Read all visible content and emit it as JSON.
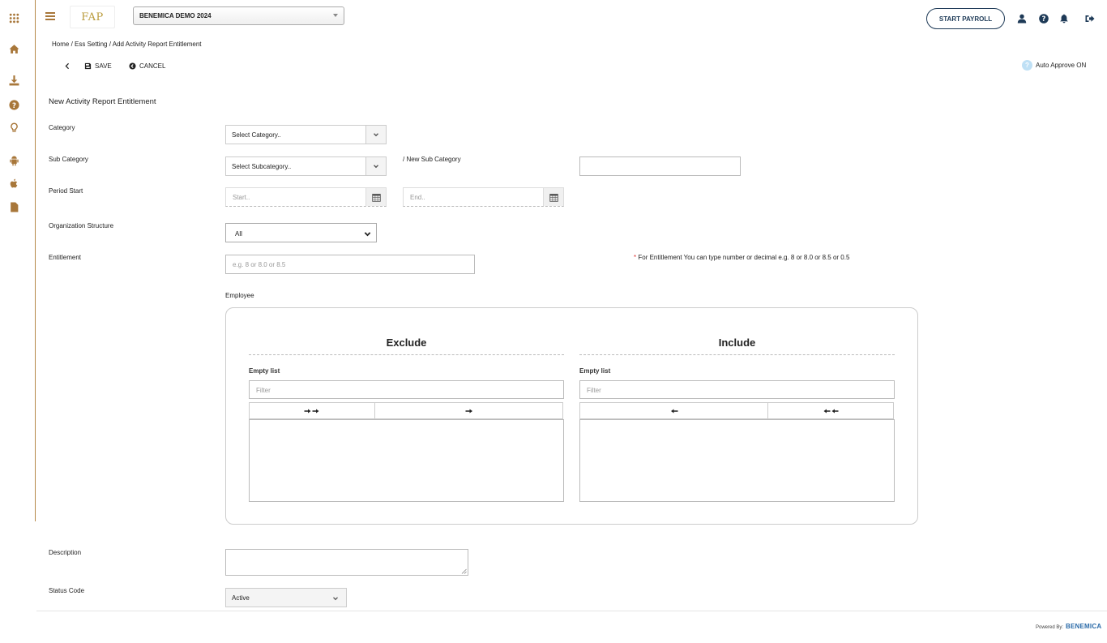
{
  "header": {
    "logo_text": "FAP",
    "company": "BENEMICA DEMO 2024",
    "start_payroll": "START PAYROLL"
  },
  "breadcrumb": "Home / Ess Setting / Add Activity Report Entitlement",
  "toolbar": {
    "save": "SAVE",
    "cancel": "CANCEL",
    "auto_approve": "Auto Approve ON"
  },
  "form": {
    "title": "New Activity Report Entitlement",
    "category_label": "Category",
    "category_value": "Select Category..",
    "subcategory_label": "Sub Category",
    "subcategory_value": "Select Subcategory..",
    "new_subcategory_label": "/ New Sub Category",
    "period_label": "Period Start",
    "start_placeholder": "Start..",
    "end_placeholder": "End..",
    "org_label": "Organization Structure",
    "org_value": "All",
    "entitlement_label": "Entitlement",
    "entitlement_placeholder": "e.g. 8 or 8.0 or 8.5",
    "entitlement_note_star": "*",
    "entitlement_note": "For Entitlement You can type number or decimal e.g. 8 or 8.0 or 8.5 or 0.5",
    "employee_label": "Employee",
    "description_label": "Description",
    "status_label": "Status Code",
    "status_value": "Active"
  },
  "dual_list": {
    "exclude_title": "Exclude",
    "include_title": "Include",
    "exclude_empty": "Empty list",
    "include_empty": "Empty list",
    "filter_placeholder": "Filter",
    "move_all_right": "➔➔",
    "move_right": "➔",
    "move_left": "🡐",
    "move_all_left": "🡐🡐"
  },
  "footer": {
    "powered_by": "Powered By:",
    "brand": "BENEMICA"
  },
  "colors": {
    "accent": "#a8773a",
    "navy": "#1e3a57"
  }
}
